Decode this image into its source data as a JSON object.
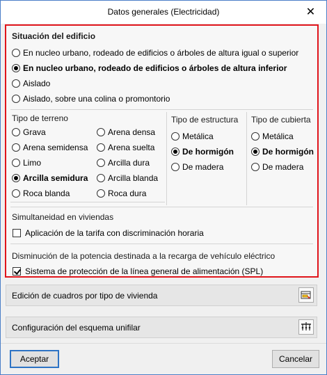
{
  "window": {
    "title": "Datos generales (Electricidad)",
    "close_glyph": "✕"
  },
  "situacion": {
    "title": "Situación del edificio",
    "options": [
      {
        "label": "En nucleo urbano, rodeado de edificios o árboles de altura igual o superior",
        "selected": false
      },
      {
        "label": "En nucleo urbano, rodeado de edificios o árboles de altura inferior",
        "selected": true
      },
      {
        "label": "Aislado",
        "selected": false
      },
      {
        "label": "Aislado, sobre una colina o promontorio",
        "selected": false
      }
    ]
  },
  "terreno": {
    "title": "Tipo de terreno",
    "options": [
      {
        "label": "Grava",
        "selected": false
      },
      {
        "label": "Arena densa",
        "selected": false
      },
      {
        "label": "Arena semidensa",
        "selected": false
      },
      {
        "label": "Arena suelta",
        "selected": false
      },
      {
        "label": "Limo",
        "selected": false
      },
      {
        "label": "Arcilla dura",
        "selected": false
      },
      {
        "label": "Arcilla semidura",
        "selected": true
      },
      {
        "label": "Arcilla blanda",
        "selected": false
      },
      {
        "label": "Roca blanda",
        "selected": false
      },
      {
        "label": "Roca dura",
        "selected": false
      }
    ]
  },
  "estructura": {
    "title": "Tipo de estructura",
    "options": [
      {
        "label": "Metálica",
        "selected": false
      },
      {
        "label": "De hormigón",
        "selected": true
      },
      {
        "label": "De madera",
        "selected": false
      }
    ]
  },
  "cubierta": {
    "title": "Tipo de cubierta",
    "options": [
      {
        "label": "Metálica",
        "selected": false
      },
      {
        "label": "De hormigón",
        "selected": true
      },
      {
        "label": "De madera",
        "selected": false
      }
    ]
  },
  "simultaneidad": {
    "title": "Simultaneidad en viviendas",
    "checkbox": {
      "label": "Aplicación de la tarifa con discriminación horaria",
      "checked": false
    }
  },
  "disminucion": {
    "title": "Disminución de la potencia destinada a la recarga de vehículo eléctrico",
    "checkbox": {
      "label": "Sistema de protección de la línea general de alimentación (SPL)",
      "checked": true
    }
  },
  "bars": {
    "edicion": {
      "label": "Edición de cuadros por tipo de vivienda",
      "icon": "edit-table-icon"
    },
    "configuracion": {
      "label": "Configuración del esquema unifilar",
      "icon": "single-line-diagram-icon"
    }
  },
  "buttons": {
    "accept": "Aceptar",
    "cancel": "Cancelar"
  },
  "colors": {
    "highlight_border": "#e0141b",
    "default_button_border": "#2d73c5",
    "window_border": "#4a7ec7"
  }
}
